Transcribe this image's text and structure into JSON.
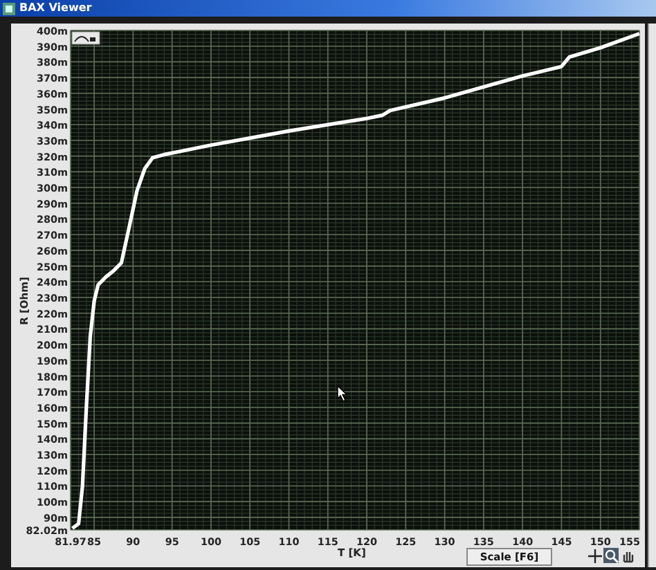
{
  "window": {
    "title": "BAX Viewer"
  },
  "chart": {
    "chart_data": {
      "type": "line",
      "xlabel": "T [K]",
      "ylabel": "R [Ohm]",
      "grid": true,
      "xlim": [
        81.97,
        155
      ],
      "ylim": [
        82.02,
        400
      ],
      "xticks": [
        {
          "value": 81.97,
          "label": "81.97"
        },
        {
          "value": 85,
          "label": "85"
        },
        {
          "value": 90,
          "label": "90"
        },
        {
          "value": 95,
          "label": "95"
        },
        {
          "value": 100,
          "label": "100"
        },
        {
          "value": 105,
          "label": "105"
        },
        {
          "value": 110,
          "label": "110"
        },
        {
          "value": 115,
          "label": "115"
        },
        {
          "value": 120,
          "label": "120"
        },
        {
          "value": 125,
          "label": "125"
        },
        {
          "value": 130,
          "label": "130"
        },
        {
          "value": 135,
          "label": "135"
        },
        {
          "value": 140,
          "label": "140"
        },
        {
          "value": 145,
          "label": "145"
        },
        {
          "value": 150,
          "label": "150"
        },
        {
          "value": 155,
          "label": "155"
        }
      ],
      "yticks": [
        {
          "value": 82.02,
          "label": "82.02m"
        },
        {
          "value": 90,
          "label": "90m"
        },
        {
          "value": 100,
          "label": "100m"
        },
        {
          "value": 110,
          "label": "110m"
        },
        {
          "value": 120,
          "label": "120m"
        },
        {
          "value": 130,
          "label": "130m"
        },
        {
          "value": 140,
          "label": "140m"
        },
        {
          "value": 150,
          "label": "150m"
        },
        {
          "value": 160,
          "label": "160m"
        },
        {
          "value": 170,
          "label": "170m"
        },
        {
          "value": 180,
          "label": "180m"
        },
        {
          "value": 190,
          "label": "190m"
        },
        {
          "value": 200,
          "label": "200m"
        },
        {
          "value": 210,
          "label": "210m"
        },
        {
          "value": 220,
          "label": "220m"
        },
        {
          "value": 230,
          "label": "230m"
        },
        {
          "value": 240,
          "label": "240m"
        },
        {
          "value": 250,
          "label": "250m"
        },
        {
          "value": 260,
          "label": "260m"
        },
        {
          "value": 270,
          "label": "270m"
        },
        {
          "value": 280,
          "label": "280m"
        },
        {
          "value": 290,
          "label": "290m"
        },
        {
          "value": 300,
          "label": "300m"
        },
        {
          "value": 310,
          "label": "310m"
        },
        {
          "value": 320,
          "label": "320m"
        },
        {
          "value": 330,
          "label": "330m"
        },
        {
          "value": 340,
          "label": "340m"
        },
        {
          "value": 350,
          "label": "350m"
        },
        {
          "value": 360,
          "label": "360m"
        },
        {
          "value": 370,
          "label": "370m"
        },
        {
          "value": 380,
          "label": "380m"
        },
        {
          "value": 390,
          "label": "390m"
        },
        {
          "value": 400,
          "label": "400m"
        }
      ],
      "x": [
        82.2,
        83,
        83.5,
        84,
        84.5,
        85,
        85.5,
        86.5,
        87.5,
        88.5,
        89.5,
        90.5,
        91.5,
        92.5,
        94,
        100,
        110,
        120,
        122,
        123,
        130,
        140,
        145,
        146,
        150,
        155
      ],
      "series": [
        {
          "color": "#ffffff",
          "values": [
            83,
            86,
            110,
            160,
            205,
            228,
            238,
            243,
            247,
            252,
            275,
            298,
            312,
            319,
            321,
            327,
            336,
            344,
            346,
            349,
            357,
            371,
            377,
            383,
            389,
            398
          ]
        }
      ]
    }
  },
  "scale_button": {
    "label": "Scale [F6]"
  },
  "tools": [
    {
      "kind": "crosshair",
      "selected": false
    },
    {
      "kind": "zoom",
      "selected": true
    },
    {
      "kind": "pan",
      "selected": false
    }
  ]
}
